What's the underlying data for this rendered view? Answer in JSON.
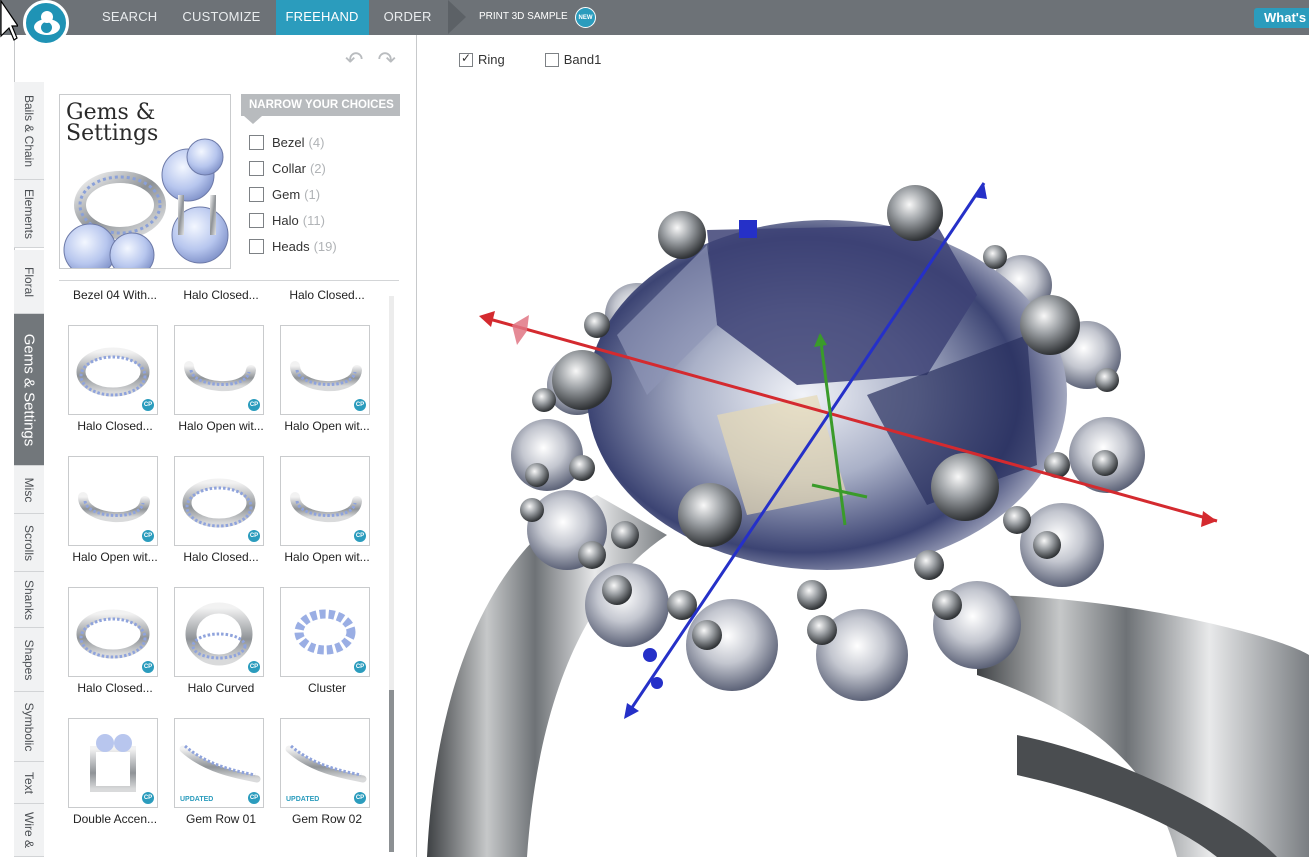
{
  "nav": {
    "items": [
      {
        "label": "SEARCH",
        "active": false
      },
      {
        "label": "CUSTOMIZE",
        "active": false
      },
      {
        "label": "FREEHAND",
        "active": true
      },
      {
        "label": "ORDER",
        "active": false
      }
    ],
    "print_sample": "PRINT 3D SAMPLE",
    "new_badge": "NEW",
    "whats_new": "What's"
  },
  "side_tabs": [
    {
      "label": "Bails & Chain",
      "active": false
    },
    {
      "label": "Elements",
      "active": false
    },
    {
      "label": "Floral",
      "active": false
    },
    {
      "label": "Gems & Settings",
      "active": true
    },
    {
      "label": "Misc",
      "active": false
    },
    {
      "label": "Scrolls",
      "active": false
    },
    {
      "label": "Shanks",
      "active": false
    },
    {
      "label": "Shapes",
      "active": false
    },
    {
      "label": "Symbolic",
      "active": false
    },
    {
      "label": "Text",
      "active": false
    },
    {
      "label": "Wire &",
      "active": false
    }
  ],
  "category": {
    "title_line1": "Gems &",
    "title_line2": "Settings"
  },
  "narrow": {
    "header": "NARROW YOUR CHOICES",
    "filters": [
      {
        "label": "Bezel",
        "count": "(4)"
      },
      {
        "label": "Collar",
        "count": "(2)"
      },
      {
        "label": "Gem",
        "count": "(1)"
      },
      {
        "label": "Halo",
        "count": "(11)"
      },
      {
        "label": "Heads",
        "count": "(19)"
      }
    ]
  },
  "top_labels": [
    "Bezel 04 With...",
    "Halo Closed...",
    "Halo Closed..."
  ],
  "tiles": [
    {
      "label": "Halo Closed...",
      "badge": "CP",
      "updated": ""
    },
    {
      "label": "Halo Open wit...",
      "badge": "CP",
      "updated": ""
    },
    {
      "label": "Halo Open wit...",
      "badge": "CP",
      "updated": ""
    },
    {
      "label": "Halo Open wit...",
      "badge": "CP",
      "updated": ""
    },
    {
      "label": "Halo Closed...",
      "badge": "CP",
      "updated": ""
    },
    {
      "label": "Halo Open wit...",
      "badge": "CP",
      "updated": ""
    },
    {
      "label": "Halo Closed...",
      "badge": "CP",
      "updated": ""
    },
    {
      "label": "Halo Curved",
      "badge": "CP",
      "updated": ""
    },
    {
      "label": "Cluster",
      "badge": "CP",
      "updated": ""
    },
    {
      "label": "Double Accen...",
      "badge": "CP",
      "updated": ""
    },
    {
      "label": "Gem Row 01",
      "badge": "CP",
      "updated": "UPDATED"
    },
    {
      "label": "Gem Row 02",
      "badge": "CP",
      "updated": "UPDATED"
    }
  ],
  "viewport": {
    "layers": [
      {
        "label": "Ring",
        "checked": true
      },
      {
        "label": "Band1",
        "checked": false
      }
    ]
  },
  "colors": {
    "nav_bg": "#6d7277",
    "accent": "#2b9cbd",
    "axis_x": "#d42a2f",
    "axis_y": "#3a9b2a",
    "axis_z": "#2530c8"
  }
}
